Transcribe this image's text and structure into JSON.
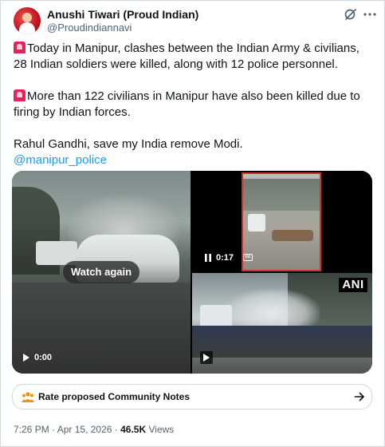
{
  "author": {
    "display_name": "Anushi Tiwari (Proud Indian)",
    "handle": "@Proudindiannavi"
  },
  "tweet": {
    "line1": "Today in Manipur, clashes between the Indian Army & civilians, 28 Indian soldiers were killed, along with 12 police personnel.",
    "line2": "More than 122 civilians in Manipur have also been killed due to firing by Indian forces.",
    "line3": "Rahul Gandhi, save my India remove Modi.",
    "mention": "@manipur_police"
  },
  "media": {
    "left_video": {
      "overlay_button": "Watch again",
      "time": "0:00"
    },
    "top_right_video": {
      "time": "0:17",
      "captions_badge": "cc"
    },
    "bottom_right_video": {
      "watermark": "ANI"
    }
  },
  "community_notes": {
    "label": "Rate proposed Community Notes"
  },
  "meta": {
    "time": "7:26 PM",
    "separator": "·",
    "date": "Apr 15, 2026",
    "views_count": "46.5K",
    "views_label": "Views"
  },
  "colors": {
    "text": "#0f1419",
    "secondary": "#536471",
    "link": "#1d9bf0",
    "border": "#cfd9de",
    "siren": "#e0245e",
    "notes_icon": "#f4900c"
  },
  "icons": {
    "header_grok": "grok-icon",
    "header_more": "more-icon",
    "siren": "siren-emoji-icon",
    "notes": "community-notes-icon",
    "arrow": "arrow-right-icon"
  }
}
